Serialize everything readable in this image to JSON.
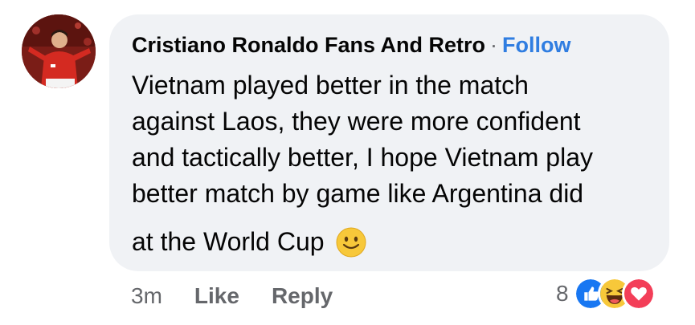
{
  "comment": {
    "author": "Cristiano Ronaldo Fans And Retro",
    "separator": "·",
    "follow_label": "Follow",
    "text_lines": "Vietnam played better in the match\nagainst Laos, they were more confident\nand tactically better, I hope Vietnam play\nbetter match by game like Argentina did",
    "text_last": "at the World Cup",
    "emoji": "slightly-smiling-face"
  },
  "actions": {
    "time": "3m",
    "like_label": "Like",
    "reply_label": "Reply"
  },
  "reactions": {
    "count": "8",
    "icons": [
      "like-icon",
      "haha-icon",
      "love-icon"
    ]
  },
  "colors": {
    "bubble": "#f0f2f5",
    "follow": "#2f7de1",
    "meta": "#65676b"
  }
}
